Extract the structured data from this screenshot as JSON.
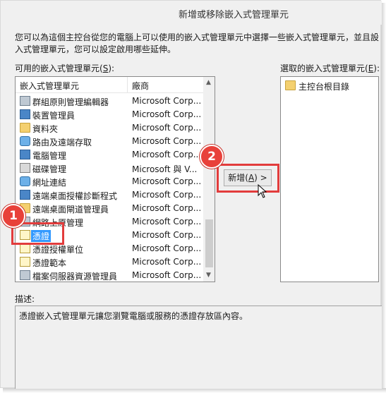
{
  "window": {
    "title": "新增或移除嵌入式管理單元"
  },
  "instructions": {
    "line1": "您可以為這個主控台從您的電腦上可以使用的嵌入式管理單元中選擇一些嵌入式管理單元，並且設",
    "line2": "入式管理單元，您可以設定啟用哪些延伸。"
  },
  "available": {
    "label_text": "可用的嵌入式管理單元(",
    "label_key": "S",
    "label_suffix": "):",
    "col_snapin": "嵌入式管理單元",
    "col_vendor": "廠商",
    "rows": [
      {
        "name": "群組原則管理編輯器",
        "vendor": "Microsoft Corp...",
        "icon": "policy-editor-icon"
      },
      {
        "name": "裝置管理員",
        "vendor": "Microsoft Corp...",
        "icon": "device-manager-icon"
      },
      {
        "name": "資料夾",
        "vendor": "Microsoft Corp...",
        "icon": "folder-icon"
      },
      {
        "name": "路由及遠端存取",
        "vendor": "Microsoft Corp...",
        "icon": "routing-icon"
      },
      {
        "name": "電腦管理",
        "vendor": "Microsoft Corp...",
        "icon": "computer-management-icon"
      },
      {
        "name": "磁碟管理",
        "vendor": "Microsoft 與 V...",
        "icon": "disk-management-icon"
      },
      {
        "name": "網址連結",
        "vendor": "Microsoft Corp...",
        "icon": "link-icon"
      },
      {
        "name": "遠端桌面授權診斷程式",
        "vendor": "Microsoft Corp...",
        "icon": "rd-licensing-icon"
      },
      {
        "name": "遠端桌面閘道管理員",
        "vendor": "Microsoft Corp...",
        "icon": "rd-gateway-icon"
      },
      {
        "name": "網路上原管理",
        "vendor": "Microsoft Corp...",
        "icon": "network-policy-icon"
      },
      {
        "name": "憑證",
        "vendor": "Microsoft Corp...",
        "icon": "certificates-icon"
      },
      {
        "name": "憑證授權單位",
        "vendor": "Microsoft Corp...",
        "icon": "certification-authority-icon"
      },
      {
        "name": "憑證範本",
        "vendor": "Microsoft Corp...",
        "icon": "certificate-templates-icon"
      },
      {
        "name": "檔案伺服器資源管理員",
        "vendor": "Microsoft Corp...",
        "icon": "fsrm-icon"
      }
    ],
    "selected_index": 10
  },
  "add_button": {
    "label_prefix": "新增(",
    "label_key": "A",
    "label_suffix": ") >"
  },
  "selected": {
    "label_text": "選取的嵌入式管理單元(",
    "label_key": "E",
    "label_suffix": "):",
    "items": [
      {
        "name": "主控台根目錄",
        "icon": "folder-icon"
      }
    ]
  },
  "description": {
    "label": "描述:",
    "text": "憑證嵌入式管理單元讓您瀏覽電腦或服務的憑證存放區內容。"
  },
  "annotations": {
    "badge1": "1",
    "badge2": "2"
  },
  "colors": {
    "highlight": "#3399ff",
    "annotation_red": "#e23c3c",
    "background": "#f0f0f0"
  }
}
